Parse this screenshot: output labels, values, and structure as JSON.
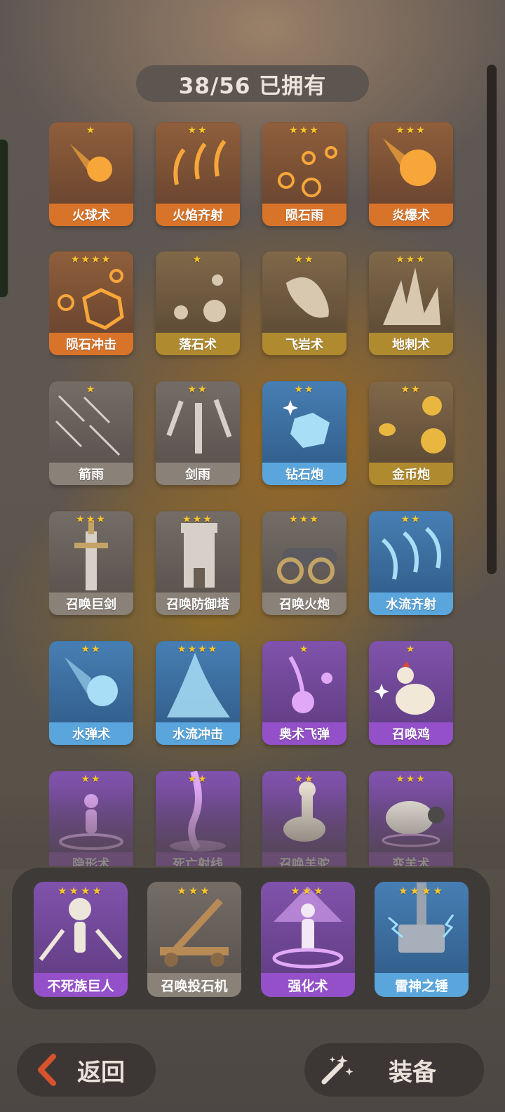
{
  "counter": {
    "text": "38/56 已拥有"
  },
  "colors": {
    "fire": "#d8742a",
    "earth": "#b08a2e",
    "grey": "#8a8178",
    "water": "#5aa6dc",
    "arcane": "#9450c8",
    "star": "#f6c52c"
  },
  "spells": [
    {
      "name": "火球术",
      "stars": "★",
      "theme": "fire",
      "icon": "fireball-icon"
    },
    {
      "name": "火焰齐射",
      "stars": "★★",
      "theme": "fire",
      "icon": "flame-volley-icon"
    },
    {
      "name": "陨石雨",
      "stars": "★★★",
      "theme": "fire",
      "icon": "meteor-rain-icon"
    },
    {
      "name": "炎爆术",
      "stars": "★★★",
      "theme": "fire",
      "icon": "pyroblast-icon"
    },
    {
      "name": "陨石冲击",
      "stars": "★★★★",
      "theme": "fire",
      "icon": "meteor-strike-icon"
    },
    {
      "name": "落石术",
      "stars": "★",
      "theme": "earth",
      "icon": "falling-rock-icon"
    },
    {
      "name": "飞岩术",
      "stars": "★★",
      "theme": "earth",
      "icon": "flying-rock-icon"
    },
    {
      "name": "地刺术",
      "stars": "★★★",
      "theme": "earth",
      "icon": "earth-spike-icon"
    },
    {
      "name": "箭雨",
      "stars": "★",
      "theme": "grey",
      "icon": "arrow-rain-icon"
    },
    {
      "name": "剑雨",
      "stars": "★★",
      "theme": "grey",
      "icon": "sword-rain-icon"
    },
    {
      "name": "钻石炮",
      "stars": "★★",
      "theme": "water",
      "icon": "diamond-cannon-icon"
    },
    {
      "name": "金币炮",
      "stars": "★★",
      "theme": "earth",
      "icon": "coin-cannon-icon"
    },
    {
      "name": "召唤巨剑",
      "stars": "★★★",
      "theme": "grey",
      "icon": "giant-sword-icon"
    },
    {
      "name": "召唤防御塔",
      "stars": "★★★",
      "theme": "grey",
      "icon": "defense-tower-icon"
    },
    {
      "name": "召唤火炮",
      "stars": "★★★",
      "theme": "grey",
      "icon": "cannon-icon"
    },
    {
      "name": "水流齐射",
      "stars": "★★",
      "theme": "water",
      "icon": "water-volley-icon"
    },
    {
      "name": "水弹术",
      "stars": "★★",
      "theme": "water",
      "icon": "water-ball-icon"
    },
    {
      "name": "水流冲击",
      "stars": "★★★★",
      "theme": "water",
      "icon": "water-burst-icon"
    },
    {
      "name": "奥术飞弹",
      "stars": "★",
      "theme": "arcane",
      "icon": "arcane-missile-icon"
    },
    {
      "name": "召唤鸡",
      "stars": "★",
      "theme": "arcane",
      "icon": "chicken-icon"
    },
    {
      "name": "隐形术",
      "stars": "★★",
      "theme": "arcane",
      "icon": "invisibility-icon"
    },
    {
      "name": "死亡射线",
      "stars": "★★",
      "theme": "arcane",
      "icon": "death-ray-icon"
    },
    {
      "name": "召唤羊驼",
      "stars": "★★",
      "theme": "arcane",
      "icon": "alpaca-icon"
    },
    {
      "name": "变羊术",
      "stars": "★★★",
      "theme": "arcane",
      "icon": "sheep-icon"
    }
  ],
  "equipped": [
    {
      "name": "不死族巨人",
      "stars": "★★★★",
      "theme": "arcane",
      "icon": "skeleton-icon"
    },
    {
      "name": "召唤投石机",
      "stars": "★★★",
      "theme": "grey",
      "icon": "catapult-icon"
    },
    {
      "name": "强化术",
      "stars": "★★★",
      "theme": "arcane",
      "icon": "empower-icon"
    },
    {
      "name": "雷神之锤",
      "stars": "★★★★",
      "theme": "water",
      "icon": "thunder-hammer-icon"
    }
  ],
  "buttons": {
    "back": "返回",
    "equip": "装备"
  }
}
